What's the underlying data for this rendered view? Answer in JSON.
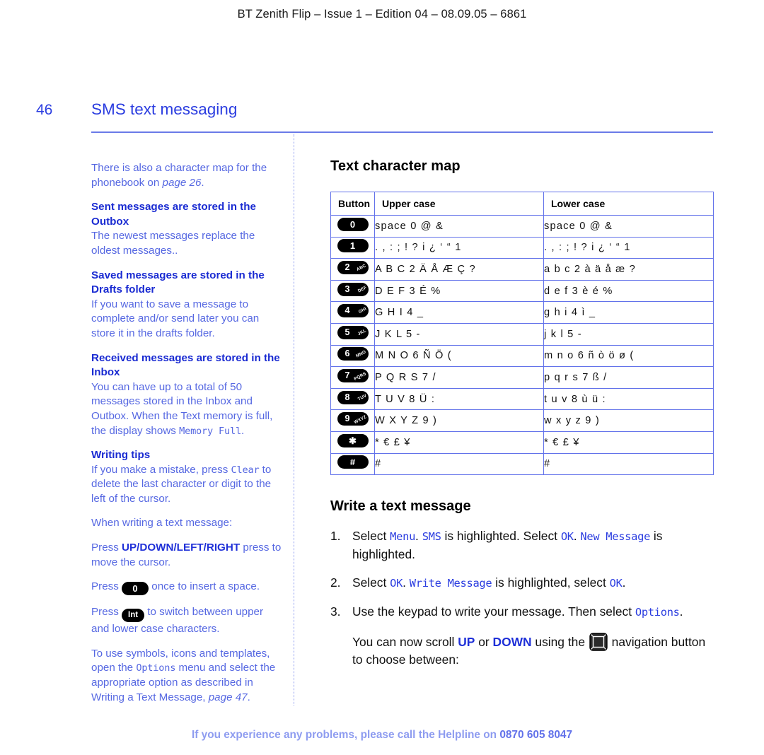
{
  "header": {
    "running_head": "BT Zenith Flip – Issue 1 – Edition 04 – 08.09.05 – 6861"
  },
  "page": {
    "number": "46",
    "title": "SMS text messaging"
  },
  "sidebar": {
    "intro": {
      "text_before": "There is also a character map for the phonebook on ",
      "page_ref": "page 26",
      "text_after": "."
    },
    "blocks": [
      {
        "heading": "Sent messages are stored in the Outbox",
        "body": "The newest messages replace the oldest messages.."
      },
      {
        "heading": "Saved messages are stored in the Drafts folder",
        "body": "If you want to save a message to complete and/or send later you can store it in the drafts folder."
      },
      {
        "heading": "Received messages are stored in the Inbox",
        "body_before": "You can have up to a total of 50 messages stored in the Inbox and Outbox. When the Text memory is full, the display shows ",
        "lcd_term": "Memory Full",
        "body_after": "."
      },
      {
        "heading": "Writing tips",
        "body_before": "If you make a mistake, press ",
        "lcd_term": "Clear",
        "body_after": " to delete the last character or digit to the left of the cursor."
      }
    ],
    "when_writing": "When writing a text message:",
    "press_nav": {
      "prefix": "Press ",
      "keys": "UP/DOWN/LEFT/RIGHT",
      "suffix": " press to move the cursor."
    },
    "press_zero": {
      "prefix": "Press ",
      "key_label": "0",
      "suffix": " once to insert a space."
    },
    "press_int": {
      "prefix": "Press ",
      "key_label": "Int",
      "suffix": " to switch between upper and lower case characters."
    },
    "symbols_note": {
      "text_before": "To use symbols, icons and templates, open the ",
      "lcd_term": "Options",
      "text_middle": " menu and select the appropriate option as described in Writing a Text Message, ",
      "page_ref": "page 47",
      "text_after": "."
    }
  },
  "charmap": {
    "title": "Text character map",
    "columns": [
      "Button",
      "Upper case",
      "Lower case"
    ],
    "rows": [
      {
        "digit": "0",
        "letters": "",
        "upper": "space 0 @ &",
        "lower": "space 0 @ &"
      },
      {
        "digit": "1",
        "letters": "",
        "upper": ". , : ; ! ? i ¿ ‘ “ 1",
        "lower": ". , : ; ! ? i ¿ ‘ “ 1"
      },
      {
        "digit": "2",
        "letters": "ABC",
        "upper": "A B C 2 Ä Å Æ Ç ?",
        "lower": "a b c 2 à ä å æ ?"
      },
      {
        "digit": "3",
        "letters": "DEF",
        "upper": "D E F 3 É %",
        "lower": "d e f 3 è é %"
      },
      {
        "digit": "4",
        "letters": "GHI",
        "upper": "G H I 4 _",
        "lower": "g h i 4 ì _"
      },
      {
        "digit": "5",
        "letters": "JKL",
        "upper": "J K L 5 -",
        "lower": "j k l 5 -"
      },
      {
        "digit": "6",
        "letters": "MNO",
        "upper": "M N O 6 Ñ Ö (",
        "lower": "m n o 6 ñ ò ö ø ("
      },
      {
        "digit": "7",
        "letters": "PQRS",
        "upper": "P Q R S 7 /",
        "lower": "p q r s 7 ß /"
      },
      {
        "digit": "8",
        "letters": "TUV",
        "upper": "T U V 8 Ü :",
        "lower": "t u v 8 ù ü :"
      },
      {
        "digit": "9",
        "letters": "WXYZ",
        "upper": "W X Y Z 9 )",
        "lower": "w x y z 9 )"
      },
      {
        "digit": "✱",
        "letters": "",
        "upper": "* € £ ¥",
        "lower": "* € £ ¥"
      },
      {
        "digit": "#",
        "letters": "",
        "upper": "#",
        "lower": "#"
      }
    ]
  },
  "write_message": {
    "title": "Write a text message",
    "step1": {
      "a": "Select ",
      "lcd1": "Menu",
      "b": ". ",
      "lcd2": "SMS",
      "c": " is highlighted. Select ",
      "lcd3": "OK",
      "d": ". ",
      "lcd4": "New Message",
      "e": " is highlighted."
    },
    "step2": {
      "a": "Select ",
      "lcd1": "OK",
      "b": ". ",
      "lcd2": "Write Message",
      "c": " is highlighted, select ",
      "lcd3": "OK",
      "d": "."
    },
    "step3": {
      "a": "Use the keypad to write your message. Then select ",
      "lcd1": "Options",
      "b": ".",
      "followup_a": "You can now scroll ",
      "dir1": "UP",
      "followup_b": " or ",
      "dir2": "DOWN",
      "followup_c": " using the ",
      "icon": "navigation-button-icon",
      "followup_d": " navigation button to choose between:"
    }
  },
  "footer": {
    "text": "If you experience any problems, please call the Helpline on ",
    "phone": "0870 605 8047"
  },
  "colors": {
    "heading_blue": "#1a2bd2",
    "body_blue": "#5668e2",
    "title_blue": "#2b3de0",
    "rule_blue": "#6a7ae8",
    "table_border": "#6272ea",
    "footer_blue": "#8e9cf0"
  }
}
